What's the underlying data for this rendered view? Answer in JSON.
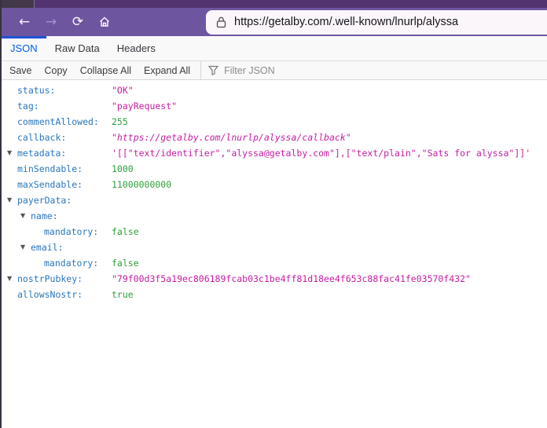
{
  "browser": {
    "url": "https://getalby.com/.well-known/lnurlp/alyssa",
    "icons": {
      "back": "←",
      "forward": "→",
      "reload": "⟳"
    }
  },
  "devtools": {
    "tabs": [
      {
        "label": "JSON",
        "active": true
      },
      {
        "label": "Raw Data",
        "active": false
      },
      {
        "label": "Headers",
        "active": false
      }
    ],
    "toolbar": {
      "buttons": [
        "Save",
        "Copy",
        "Collapse All",
        "Expand All"
      ],
      "filter_placeholder": "Filter JSON"
    }
  },
  "json_tree": {
    "twisty_icon": "▼",
    "rows": [
      {
        "indent": 0,
        "twisty": false,
        "key": "status:",
        "value": "\"OK\"",
        "type": "string"
      },
      {
        "indent": 0,
        "twisty": false,
        "key": "tag:",
        "value": "\"payRequest\"",
        "type": "string"
      },
      {
        "indent": 0,
        "twisty": false,
        "key": "commentAllowed:",
        "value": "255",
        "type": "number"
      },
      {
        "indent": 0,
        "twisty": false,
        "key": "callback:",
        "value": "\"https://getalby.com/lnurlp/alyssa/callback\"",
        "type": "url"
      },
      {
        "indent": 0,
        "twisty": true,
        "key": "metadata:",
        "value": "'[[\"text/identifier\",\"alyssa@getalby.com\"],[\"text/plain\",\"Sats for alyssa\"]]'",
        "type": "string"
      },
      {
        "indent": 0,
        "twisty": false,
        "key": "minSendable:",
        "value": "1000",
        "type": "number"
      },
      {
        "indent": 0,
        "twisty": false,
        "key": "maxSendable:",
        "value": "11000000000",
        "type": "number"
      },
      {
        "indent": 0,
        "twisty": true,
        "key": "payerData:",
        "value": "",
        "type": "object"
      },
      {
        "indent": 1,
        "twisty": true,
        "key": "name:",
        "value": "",
        "type": "object"
      },
      {
        "indent": 2,
        "twisty": false,
        "key": "mandatory:",
        "value": "false",
        "type": "boolean"
      },
      {
        "indent": 1,
        "twisty": true,
        "key": "email:",
        "value": "",
        "type": "object"
      },
      {
        "indent": 2,
        "twisty": false,
        "key": "mandatory:",
        "value": "false",
        "type": "boolean"
      },
      {
        "indent": 0,
        "twisty": true,
        "key": "nostrPubkey:",
        "value": "\"79f00d3f5a19ec806189fcab03c1be4ff81d18ee4f653c88fac41fe03570f432\"",
        "type": "string"
      },
      {
        "indent": 0,
        "twisty": false,
        "key": "allowsNostr:",
        "value": "true",
        "type": "boolean"
      }
    ]
  },
  "colors": {
    "chrome_titlebar": "#533470",
    "chrome_navbar": "#6e55a0",
    "active_tab_accent": "#1d53d3",
    "tab_active_text": "#0060df",
    "json_key": "#2a76bb",
    "json_string": "#c51ea2",
    "json_number": "#2f9e3b"
  }
}
